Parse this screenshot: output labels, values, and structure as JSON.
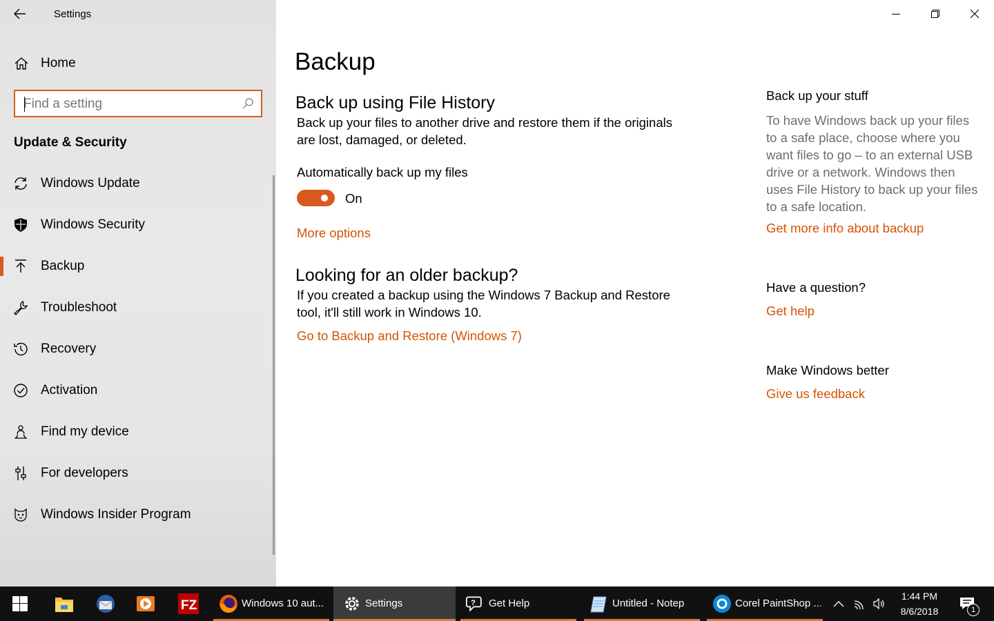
{
  "window": {
    "title": "Settings"
  },
  "sidebar": {
    "home_label": "Home",
    "search_placeholder": "Find a setting",
    "section_title": "Update & Security",
    "items": [
      {
        "label": "Windows Update",
        "icon": "sync-icon"
      },
      {
        "label": "Windows Security",
        "icon": "shield-icon"
      },
      {
        "label": "Backup",
        "icon": "upload-arrow-icon",
        "active": true
      },
      {
        "label": "Troubleshoot",
        "icon": "wrench-icon"
      },
      {
        "label": "Recovery",
        "icon": "history-icon"
      },
      {
        "label": "Activation",
        "icon": "check-circle-icon"
      },
      {
        "label": "Find my device",
        "icon": "person-pin-icon"
      },
      {
        "label": "For developers",
        "icon": "sliders-icon"
      },
      {
        "label": "Windows Insider Program",
        "icon": "insider-cat-icon"
      }
    ]
  },
  "main": {
    "title": "Backup",
    "file_history": {
      "heading": "Back up using File History",
      "description_line1": "Back up your files to another drive and restore them if the originals",
      "description_line2": "are lost, damaged, or deleted.",
      "toggle_label": "Automatically back up my files",
      "toggle_state": "On",
      "more_options": "More options"
    },
    "older_backup": {
      "heading": "Looking for an older backup?",
      "description_line1": "If you created a backup using the Windows 7 Backup and Restore",
      "description_line2": "tool, it'll still work in Windows 10.",
      "link": "Go to Backup and Restore (Windows 7)"
    }
  },
  "side_panel": {
    "backup_heading": "Back up your stuff",
    "backup_text": "To have Windows back up your files to a safe place, choose where you want files to go – to an external USB drive or a network. Windows then uses File History to back up your files to a safe location.",
    "backup_link": "Get more info about backup",
    "question_heading": "Have a question?",
    "question_link": "Get help",
    "feedback_heading": "Make Windows better",
    "feedback_link": "Give us feedback"
  },
  "taskbar": {
    "apps": [
      {
        "label": "Windows 10 aut...",
        "icon": "firefox-icon"
      },
      {
        "label": "Settings",
        "icon": "gear-icon",
        "active": true
      },
      {
        "label": "Get Help",
        "icon": "get-help-icon"
      },
      {
        "label": "Untitled - Notep",
        "icon": "notepad-icon"
      },
      {
        "label": "Corel PaintShop ...",
        "icon": "paintshop-icon"
      }
    ],
    "time": "1:44 PM",
    "date": "8/6/2018",
    "notification_count": "1"
  },
  "colors": {
    "accent": "#d95a1f",
    "link": "#d35400",
    "taskbar": "#111111"
  }
}
